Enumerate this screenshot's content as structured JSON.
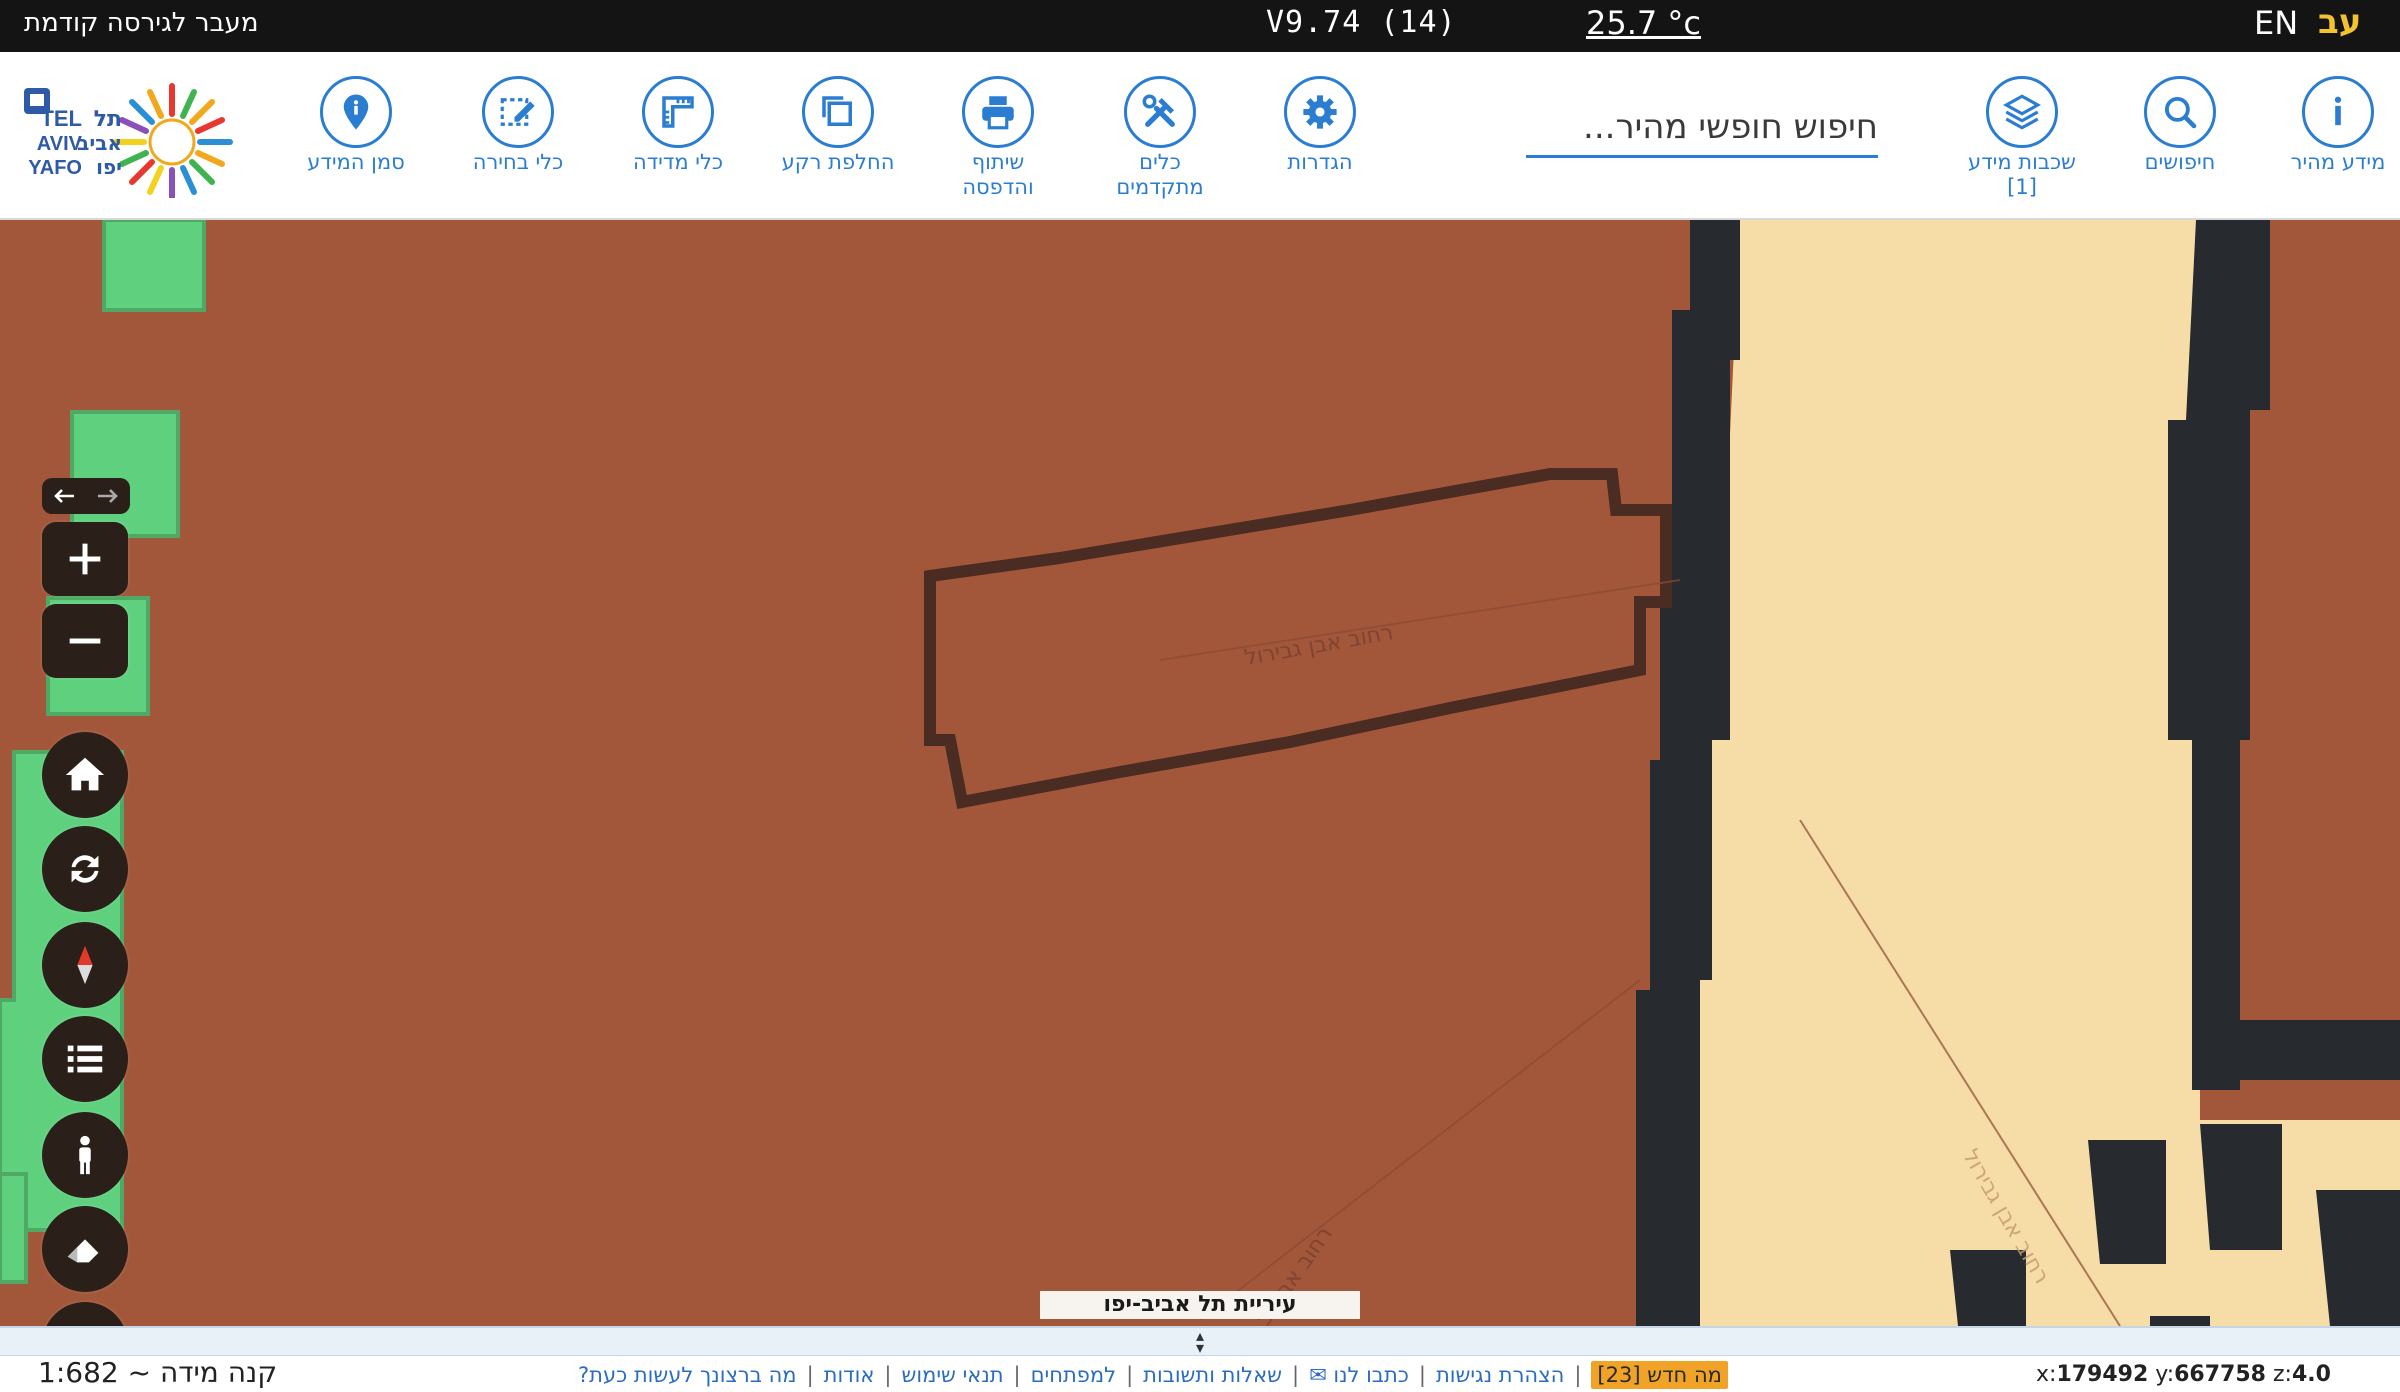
{
  "topbar": {
    "prev_version_link": "מעבר לגירסה קודמת",
    "version": "V9.74 (14)",
    "temperature": "25.7 °c",
    "lang_en": "EN",
    "lang_he": "עב"
  },
  "toolbar": {
    "quick_info": "מידע מהיר",
    "searches": "חיפושים",
    "layers_line1": "שכבות מידע",
    "layers_count": "[1]",
    "search_placeholder": "חיפוש חופשי מהיר...",
    "settings": "הגדרות",
    "advanced_tools_line1": "כלים",
    "advanced_tools_line2": "מתקדמים",
    "share_print_line1": "שיתוף",
    "share_print_line2": "והדפסה",
    "switch_background": "החלפת רקע",
    "measure_tools": "כלי מדידה",
    "select_tools": "כלי בחירה",
    "mark_info": "סמן המידע",
    "logo_text_en1": "TEL",
    "logo_text_en2": "AVIV",
    "logo_text_en3": "YAFO",
    "logo_text_he1": "תל",
    "logo_text_he2": "אביב",
    "logo_text_he3": "יפו"
  },
  "map": {
    "street_label_1": "רחוב אבן גבירול",
    "street_label_2": "רחוב אבן גבירול",
    "street_label_3": "רחוב אבן גב",
    "city_label": "עיריית תל אביב-יפו",
    "controls": {
      "three_d": "3D"
    },
    "colors": {
      "land": "#a2573a",
      "building_outline": "#272a2e",
      "sand": "#f6dca6",
      "green": "#5fd17e"
    }
  },
  "footer": {
    "scale": "קנה מידה ~ 1:682",
    "links": [
      "מה ברצונך לעשות כעת?",
      "אודות",
      "תנאי שימוש",
      "למפתחים",
      "שאלות ותשובות",
      "כתבו לנו ✉",
      "הצהרת נגישות"
    ],
    "whats_new": "מה חדש [23]",
    "coord_x_label": "x:",
    "coord_x": "179492",
    "coord_y_label": " y:",
    "coord_y": "667758",
    "coord_z_label": " z:",
    "coord_z": "4.0"
  }
}
